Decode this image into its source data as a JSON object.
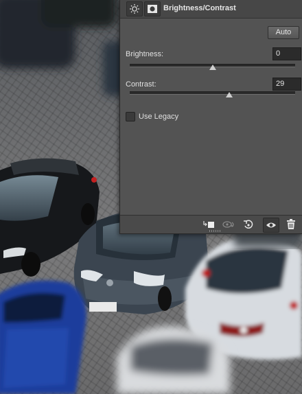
{
  "panel": {
    "title": "Brightness/Contrast",
    "header_icons": [
      "brightness-contrast-icon",
      "mask-icon"
    ],
    "auto_label": "Auto",
    "brightness": {
      "label": "Brightness:",
      "value": "0",
      "slider_level": 0.5
    },
    "contrast": {
      "label": "Contrast:",
      "value": "29",
      "slider_level": 0.6
    },
    "use_legacy": {
      "label": "Use Legacy",
      "checked": false
    },
    "footer_icons": [
      "clip-to-layer-icon",
      "view-previous-state-icon",
      "reset-icon",
      "visibility-eye-icon",
      "delete-trash-icon"
    ]
  },
  "background": {
    "description_colors": {
      "asphalt": "#6a6b6d",
      "dark_car": "#1c1f24",
      "blue_car": "#2240a0",
      "white_car": "#dde1e6",
      "gray_car": "#5a6570"
    }
  }
}
